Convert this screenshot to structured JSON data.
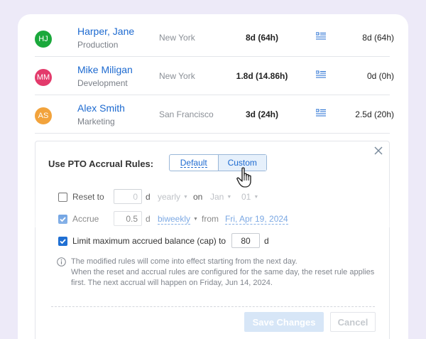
{
  "employees": [
    {
      "initials": "HJ",
      "color": "#1aa83b",
      "name": "Harper, Jane",
      "department": "Production",
      "location": "New York",
      "balance": "8d (64h)",
      "total": "8d (64h)"
    },
    {
      "initials": "MM",
      "color": "#e33a6b",
      "name": "Mike Miligan",
      "department": "Development",
      "location": "New York",
      "balance": "1.8d (14.86h)",
      "total": "0d (0h)"
    },
    {
      "initials": "AS",
      "color": "#f2a33c",
      "name": "Alex Smith",
      "department": "Marketing",
      "location": "San Francisco",
      "balance": "3d (24h)",
      "total": "2.5d (20h)"
    }
  ],
  "rules": {
    "title": "Use PTO Accrual Rules:",
    "mode_default": "Default",
    "mode_custom": "Custom",
    "selected_mode": "Custom",
    "reset": {
      "label": "Reset to",
      "checked": false,
      "value": "0",
      "unit": "d",
      "frequency": "yearly",
      "on_label": "on",
      "month": "Jan",
      "day": "01"
    },
    "accrue": {
      "label": "Accrue",
      "checked": true,
      "value": "0.5",
      "unit": "d",
      "frequency": "biweekly",
      "from_label": "from",
      "from_date": "Fri, Apr 19, 2024"
    },
    "cap": {
      "label": "Limit maximum accrued balance (cap) to",
      "checked": true,
      "value": "80",
      "unit": "d"
    },
    "info_line1": "The modified rules will come into effect starting from the next day.",
    "info_line2": "When the reset and accrual rules are configured for the same day, the reset rule applies first. The next accrual will happen on Friday, Jun 14, 2024."
  },
  "actions": {
    "save_label": "Save Changes",
    "cancel_label": "Cancel"
  }
}
